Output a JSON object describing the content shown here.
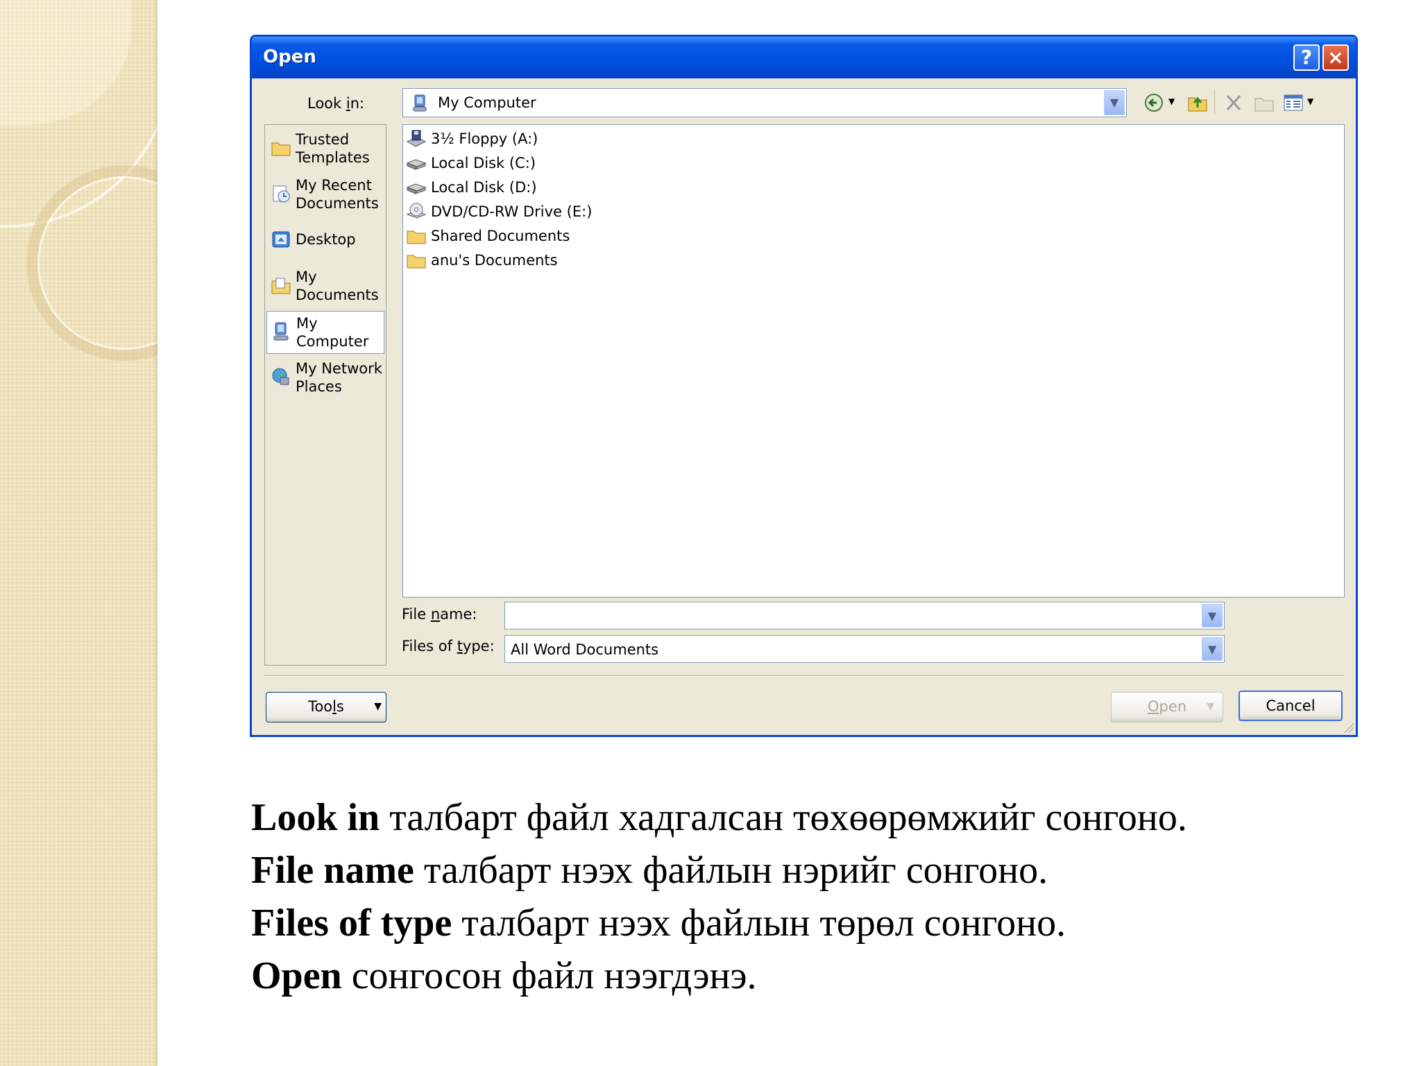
{
  "dialog": {
    "title": "Open",
    "help_button": "?",
    "close_button": "×",
    "look_in": {
      "label_pre": "Look ",
      "label_u": "i",
      "label_post": "n:",
      "value": "My Computer"
    },
    "places": [
      {
        "line1": "Trusted",
        "line2": "Templates",
        "icon": "folder-icon"
      },
      {
        "line1": "My Recent",
        "line2": "Documents",
        "icon": "recent-documents-icon"
      },
      {
        "line1": "Desktop",
        "line2": "",
        "icon": "desktop-icon"
      },
      {
        "line1": "My",
        "line2": "Documents",
        "icon": "my-documents-icon"
      },
      {
        "line1": "My",
        "line2": "Computer",
        "icon": "my-computer-icon",
        "selected": true
      },
      {
        "line1": "My Network",
        "line2": "Places",
        "icon": "network-places-icon"
      }
    ],
    "files": [
      {
        "name": "3½ Floppy (A:)",
        "icon": "floppy-drive-icon"
      },
      {
        "name": "Local Disk (C:)",
        "icon": "hard-disk-icon"
      },
      {
        "name": "Local Disk (D:)",
        "icon": "hard-disk-icon"
      },
      {
        "name": "DVD/CD-RW Drive (E:)",
        "icon": "cd-drive-icon"
      },
      {
        "name": "Shared Documents",
        "icon": "folder-icon"
      },
      {
        "name": "anu's Documents",
        "icon": "folder-icon"
      }
    ],
    "file_name": {
      "label_pre": "File ",
      "label_u": "n",
      "label_post": "ame:",
      "value": ""
    },
    "files_of_type": {
      "label_pre": "Files of ",
      "label_u": "t",
      "label_post": "ype:",
      "value": "All Word Documents"
    },
    "tools_button": {
      "pre": "Too",
      "u": "l",
      "post": "s"
    },
    "open_button": {
      "pre": "",
      "u": "O",
      "post": "pen"
    },
    "cancel_button": "Cancel"
  },
  "caption": [
    {
      "bold": "Look in",
      "rest": " талбарт файл хадгалсан төхөөрөмжийг сонгоно."
    },
    {
      "bold": "File name",
      "rest": " талбарт нээх файлын нэрийг сонгоно."
    },
    {
      "bold": "Files of type",
      "rest": " талбарт нээх файлын төрөл сонгоно."
    },
    {
      "bold": "Open",
      "rest": " сонгосон файл нээгдэнэ."
    }
  ],
  "colors": {
    "titlebar": "#0050e0",
    "dialog_bg": "#ece9d8",
    "border": "#0a47d0"
  }
}
